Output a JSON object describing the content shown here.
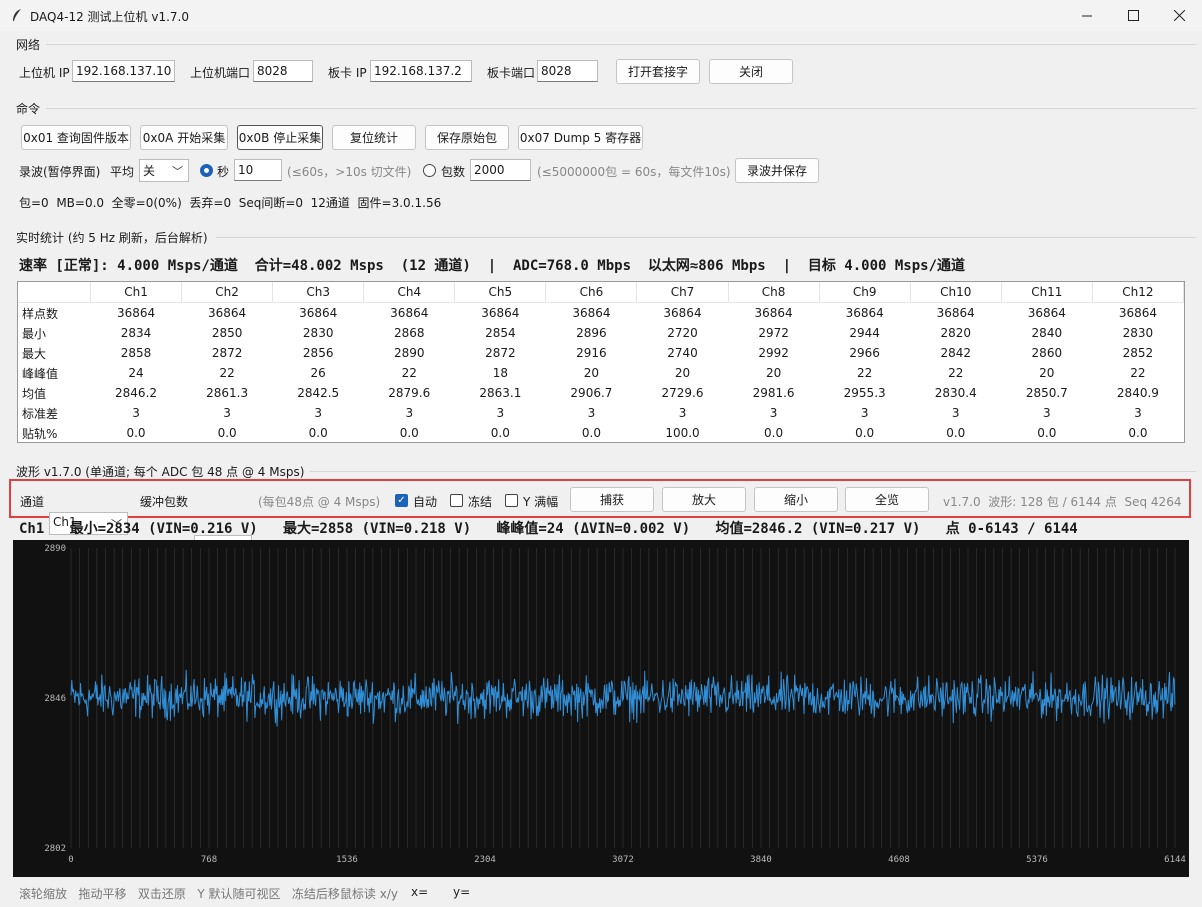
{
  "window": {
    "title": "DAQ4-12 测试上位机 v1.7.0"
  },
  "network": {
    "group": "网络",
    "host_ip_label": "上位机 IP",
    "host_ip": "192.168.137.10",
    "host_port_label": "上位机端口",
    "host_port": "8028",
    "board_ip_label": "板卡 IP",
    "board_ip": "192.168.137.2",
    "board_port_label": "板卡端口",
    "board_port": "8028",
    "open_socket": "打开套接字",
    "close": "关闭"
  },
  "commands": {
    "group": "命令",
    "buttons": [
      "0x01 查询固件版本",
      "0x0A 开始采集",
      "0x0B 停止采集",
      "复位统计",
      "保存原始包",
      "0x07 Dump 5 寄存器"
    ],
    "record_label": "录波(暂停界面)",
    "avg_label": "平均",
    "avg_value": "关",
    "sec_label": "秒",
    "sec_value": "10",
    "sec_hint": "(≤60s，>10s 切文件)",
    "pkt_label": "包数",
    "pkt_value": "2000",
    "pkt_hint": "(≤5000000包 = 60s，每文件10s)",
    "record_save": "录波并保存",
    "status": "包=0  MB=0.0  全零=0(0%)  丢弃=0  Seq间断=0  12通道  固件=3.0.1.56"
  },
  "stats": {
    "group": "实时统计 (约 5 Hz 刷新，后台解析)",
    "rate_line": "速率 [正常]: 4.000 Msps/通道  合计=48.002 Msps  (12 通道)  |  ADC=768.0 Mbps  以太网≈806 Mbps  |  目标 4.000 Msps/通道",
    "columns": [
      "Ch1",
      "Ch2",
      "Ch3",
      "Ch4",
      "Ch5",
      "Ch6",
      "Ch7",
      "Ch8",
      "Ch9",
      "Ch10",
      "Ch11",
      "Ch12"
    ],
    "rows": [
      {
        "label": "样点数",
        "values": [
          "36864",
          "36864",
          "36864",
          "36864",
          "36864",
          "36864",
          "36864",
          "36864",
          "36864",
          "36864",
          "36864",
          "36864"
        ]
      },
      {
        "label": "最小",
        "values": [
          "2834",
          "2850",
          "2830",
          "2868",
          "2854",
          "2896",
          "2720",
          "2972",
          "2944",
          "2820",
          "2840",
          "2830"
        ]
      },
      {
        "label": "最大",
        "values": [
          "2858",
          "2872",
          "2856",
          "2890",
          "2872",
          "2916",
          "2740",
          "2992",
          "2966",
          "2842",
          "2860",
          "2852"
        ]
      },
      {
        "label": "峰峰值",
        "values": [
          "24",
          "22",
          "26",
          "22",
          "18",
          "20",
          "20",
          "20",
          "22",
          "22",
          "20",
          "22"
        ]
      },
      {
        "label": "均值",
        "values": [
          "2846.2",
          "2861.3",
          "2842.5",
          "2879.6",
          "2863.1",
          "2906.7",
          "2729.6",
          "2981.6",
          "2955.3",
          "2830.4",
          "2850.7",
          "2840.9"
        ]
      },
      {
        "label": "标准差",
        "values": [
          "3",
          "3",
          "3",
          "3",
          "3",
          "3",
          "3",
          "3",
          "3",
          "3",
          "3",
          "3"
        ]
      },
      {
        "label": "贴轨%",
        "values": [
          "0.0",
          "0.0",
          "0.0",
          "0.0",
          "0.0",
          "0.0",
          "100.0",
          "0.0",
          "0.0",
          "0.0",
          "0.0",
          "0.0"
        ]
      }
    ]
  },
  "waveform": {
    "group": "波形 v1.7.0 (单通道; 每个 ADC 包 48 点 @ 4 Msps)",
    "channel_label": "通道",
    "channel": "Ch1",
    "buffer_label": "缓冲包数",
    "buffer": "128",
    "buffer_hint": "(每包48点 @ 4 Msps)",
    "auto_label": "自动",
    "auto_checked": true,
    "freeze_label": "冻结",
    "freeze_checked": false,
    "yfull_label": "Y 满幅",
    "yfull_checked": false,
    "capture": "捕获",
    "zoom_in": "放大",
    "zoom_out": "缩小",
    "fit_all": "全览",
    "status": "v1.7.0  波形: 128 包 / 6144 点  Seq 4264",
    "info": "Ch1   最小=2834 (VIN=0.216 V)   最大=2858 (VIN=0.218 V)   峰峰值=24 (ΔVIN=0.002 V)   均值=2846.2 (VIN=0.217 V)   点 0-6143 / 6144"
  },
  "chart_data": {
    "type": "line",
    "title": "",
    "xlabel": "",
    "ylabel": "",
    "xlim": [
      0,
      6144
    ],
    "ylim": [
      2802,
      2890
    ],
    "x_ticks": [
      "0",
      "768",
      "1536",
      "2304",
      "3072",
      "3840",
      "4608",
      "5376",
      "6144"
    ],
    "y_ticks": [
      "2890",
      "2846",
      "2802"
    ],
    "series": [
      {
        "mean": 2846.2,
        "min": 2834,
        "max": 2858,
        "points": 6144
      }
    ],
    "colors": {
      "line": "#2f8fd8",
      "background": "#111111",
      "grid": "#3a3a3a"
    }
  },
  "footer": {
    "hints": "滚轮缩放   拖动平移   双击还原   Y 默认随可视区   冻结后移鼠标读 x/y",
    "x_label": "x=",
    "y_label": "y="
  }
}
